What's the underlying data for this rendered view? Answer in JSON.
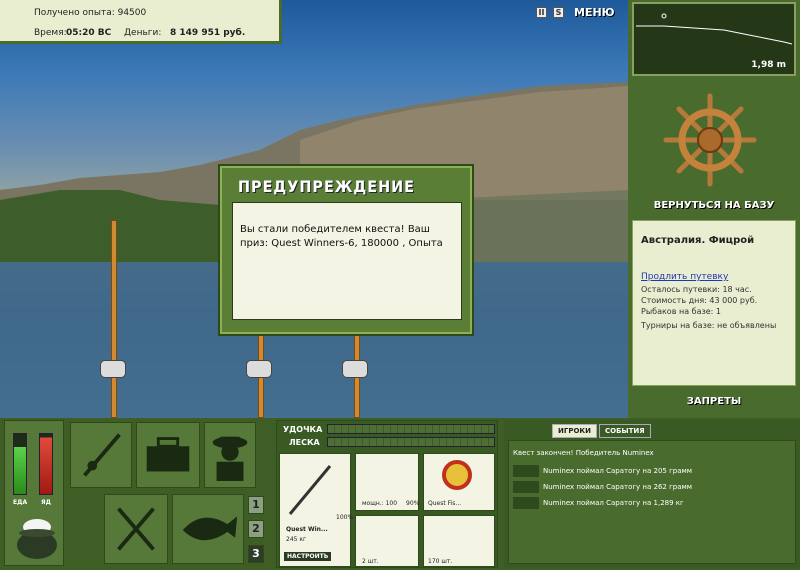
{
  "hud": {
    "xp_label": "Получено опыта: 94500",
    "time_label": "Время:",
    "time_value": "05:20 ВС",
    "money_label": "Деньги:",
    "money_value": "8 149 951 руб."
  },
  "topbar": {
    "btn_pause": "II",
    "btn_s": "S",
    "menu_label": "МЕНЮ"
  },
  "depth": {
    "value": "1,98 m"
  },
  "base": {
    "back_label": "ВЕРНУТЬСЯ НА БАЗУ",
    "location": "Австралия. Фицрой",
    "extend_link": "Продлить путевку",
    "lines": [
      "Осталось путевки: 18 час.",
      "Стоимость дня: 43 000 руб.",
      "Рыбаков на базе: 1"
    ],
    "tournaments": "Турниры на базе: не объявлены",
    "bans_label": "ЗАПРЕТЫ"
  },
  "dialog": {
    "title": "ПРЕДУПРЕЖДЕНИЕ",
    "message": "Вы стали победителем квеста! Ваш приз: Quest Winners-6, 180000 , Опыта"
  },
  "status": {
    "food_label": "ЕДА",
    "poison_label": "ЯД",
    "food_level": 0.78,
    "poison_level": 0.94
  },
  "pages": [
    "1",
    "2",
    "3"
  ],
  "tackle": {
    "rod_label": "УДОЧКА",
    "line_label": "ЛЕСКА",
    "rod_name": "Quest Win...",
    "rod_weight": "245 кг",
    "rod_percent": "100%",
    "setup_label": "НАСТРОИТЬ",
    "reel_caption": "мощн.: 100",
    "reel_percent": "90%",
    "line_caption": "Quest Fis...",
    "hook_caption": "2 шт.",
    "bait_caption": "170 шт."
  },
  "log": {
    "tab_players": "ИГРОКИ",
    "tab_events": "СОБЫТИЯ",
    "header": "Квест закончен! Победитель Numinex",
    "rows": [
      "Numinex поймал Саратогу на 205 грамм",
      "Numinex поймал Саратогу на 262 грамм",
      "Numinex поймал Саратогу на 1,289 кг"
    ]
  },
  "colors": {
    "panel": "#4a6b2e",
    "dark": "#3f5e26",
    "cream": "#eaeed0",
    "accent_link": "#1f38b5"
  }
}
